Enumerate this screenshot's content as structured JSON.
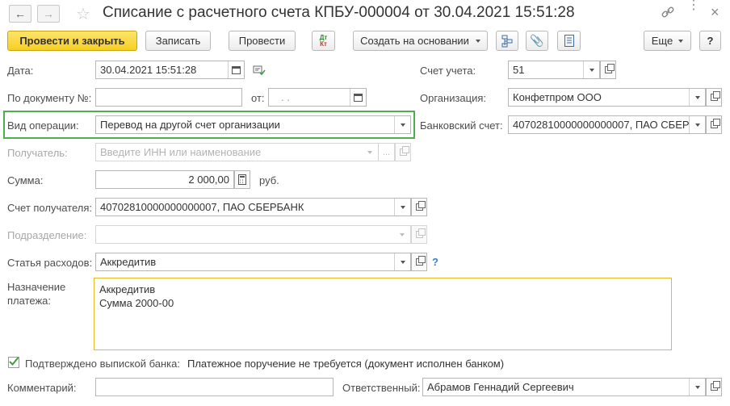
{
  "title": "Списание с расчетного счета КПБУ-000004 от 30.04.2021 15:51:28",
  "toolbar": {
    "post_close": "Провести и закрыть",
    "write": "Записать",
    "post": "Провести",
    "dtkt": "Дт Кт",
    "create_based": "Создать на основании",
    "more": "Еще",
    "help": "?"
  },
  "form": {
    "date_label": "Дата:",
    "date_value": "30.04.2021 15:51:28",
    "doc_no_label": "По документу №:",
    "doc_no_value": "",
    "from_label": "от:",
    "from_value": " .  .",
    "op_type_label": "Вид операции:",
    "op_type_value": "Перевод на другой счет организации",
    "recipient_label": "Получатель:",
    "recipient_placeholder": "Введите ИНН или наименование",
    "amount_label": "Сумма:",
    "amount_value": "2 000,00",
    "currency": "руб.",
    "recipient_account_label": "Счет получателя:",
    "recipient_account_value": "40702810000000000007, ПАО СБЕРБАНК",
    "department_label": "Подразделение:",
    "department_value": "",
    "expense_label": "Статья расходов:",
    "expense_value": "Аккредитив",
    "expense_help": "?",
    "purpose_label": "Назначение\nплатежа:",
    "purpose_value": "Аккредитив\nСумма 2000-00",
    "account_label": "Счет учета:",
    "account_value": "51",
    "org_label": "Организация:",
    "org_value": "Конфетпром ООО",
    "bank_account_label": "Банковский счет:",
    "bank_account_value": "40702810000000000007, ПАО СБЕР",
    "confirmed_label": "Подтверждено выпиской банка:",
    "confirmed_checked": true,
    "confirmed_note": "Платежное поручение не требуется (документ исполнен банком)",
    "comment_label": "Комментарий:",
    "comment_value": "",
    "responsible_label": "Ответственный:",
    "responsible_value": "Абрамов Геннадий Сергеевич"
  }
}
